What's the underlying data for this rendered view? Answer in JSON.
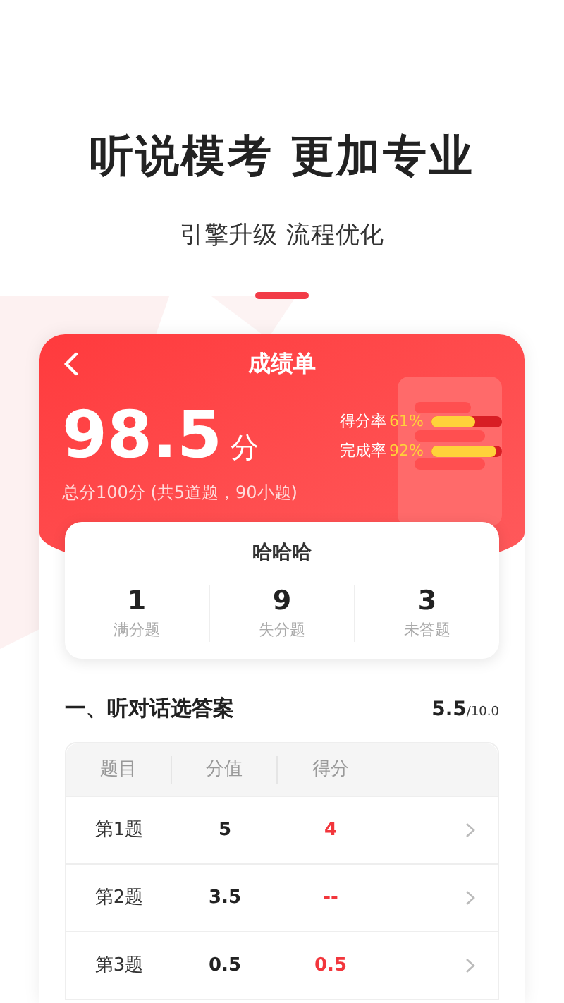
{
  "headline": "听说模考 更加专业",
  "subtitle": "引擎升级 流程优化",
  "header": {
    "title": "成绩单",
    "score": "98.5",
    "score_unit": "分",
    "summary": "总分100分 (共5道题，90小题)"
  },
  "rates": [
    {
      "label": "得分率",
      "reading": "61%",
      "level": 0.61
    },
    {
      "label": "完成率",
      "reading": "92%",
      "level": 0.92
    }
  ],
  "student": {
    "name": "哈哈哈",
    "stats": [
      {
        "value": "1",
        "label": "满分题"
      },
      {
        "value": "9",
        "label": "失分题"
      },
      {
        "value": "3",
        "label": "未答题"
      }
    ]
  },
  "section": {
    "title": "一、听对话选答案",
    "score": "5.5",
    "total": "/10.0"
  },
  "table": {
    "columns": [
      "题目",
      "分值",
      "得分"
    ],
    "rows": [
      {
        "question": "第1题",
        "value": "5",
        "score": "4"
      },
      {
        "question": "第2题",
        "value": "3.5",
        "score": "--"
      },
      {
        "question": "第3题",
        "value": "0.5",
        "score": "0.5"
      }
    ]
  }
}
